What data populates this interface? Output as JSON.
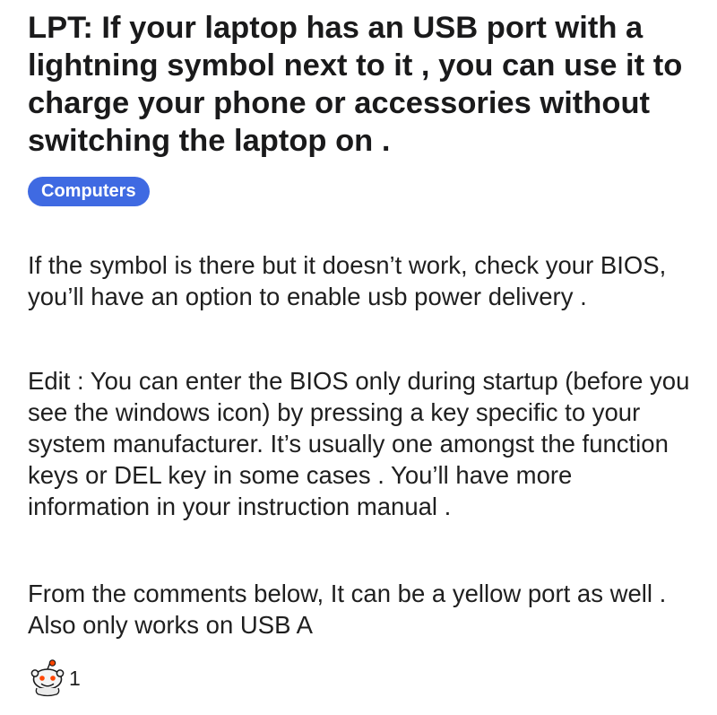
{
  "post": {
    "title": "LPT: If your laptop has an USB port with a lightning symbol next to it , you can use it to charge your phone or accessories without switching the laptop on .",
    "flair": "Computers",
    "flair_color": "#3f6ae2",
    "paragraphs": [
      "If the symbol is there but it doesn’t work, check your BIOS, you’ll have an option to enable usb power delivery .",
      "Edit : You can enter the BIOS only during startup (before you see the windows icon) by pressing a key specific to your system manufacturer. It’s usually one amongst the function keys or DEL key in some cases . You’ll have more information in your instruction manual .",
      "From the comments below, It can be a yellow port as well . Also only works on USB A"
    ],
    "awards": {
      "icon": "snoo-award-icon",
      "count": "1"
    }
  }
}
